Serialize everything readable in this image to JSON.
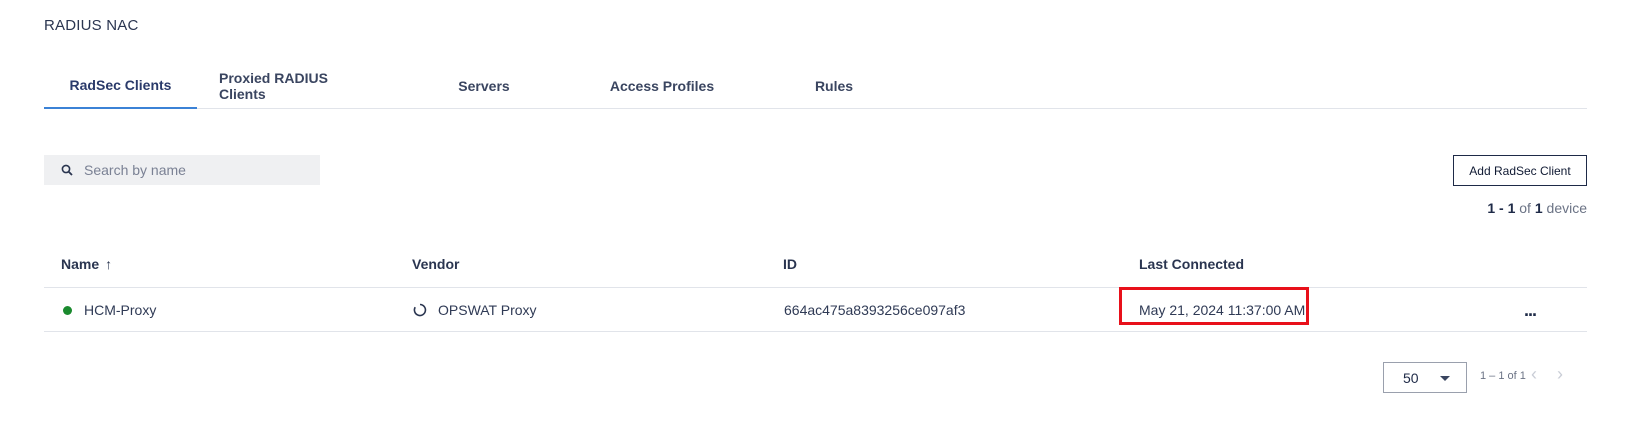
{
  "page": {
    "title": "RADIUS NAC"
  },
  "tabs": [
    {
      "label": "RadSec Clients",
      "active": true
    },
    {
      "label": "Proxied RADIUS Clients"
    },
    {
      "label": "Servers"
    },
    {
      "label": "Access Profiles"
    },
    {
      "label": "Rules"
    }
  ],
  "search": {
    "placeholder": "Search by name",
    "value": "",
    "icon": "search-icon"
  },
  "toolbar": {
    "add_label": "Add RadSec Client"
  },
  "count": {
    "range": "1 - 1",
    "of": "of",
    "total": "1",
    "unit": "device"
  },
  "table": {
    "columns": [
      "Name",
      "Vendor",
      "ID",
      "Last Connected"
    ],
    "sort_indicator": "↑",
    "rows": [
      {
        "name": "HCM-Proxy",
        "status": "online",
        "status_color": "#1a8a2e",
        "vendor": "OPSWAT Proxy",
        "vendor_icon": "spinner-icon",
        "id": "664ac475a8393256ce097af3",
        "last_connected": "May 21, 2024 11:37:00 AM",
        "actions": "..."
      }
    ]
  },
  "pagination": {
    "page_size": "50",
    "range_text": "1 – 1 of 1",
    "prev_icon": "‹",
    "next_icon": "›"
  },
  "colors": {
    "accent": "#3b82d6",
    "highlight": "#e8101a",
    "status_online": "#1a8a2e"
  }
}
